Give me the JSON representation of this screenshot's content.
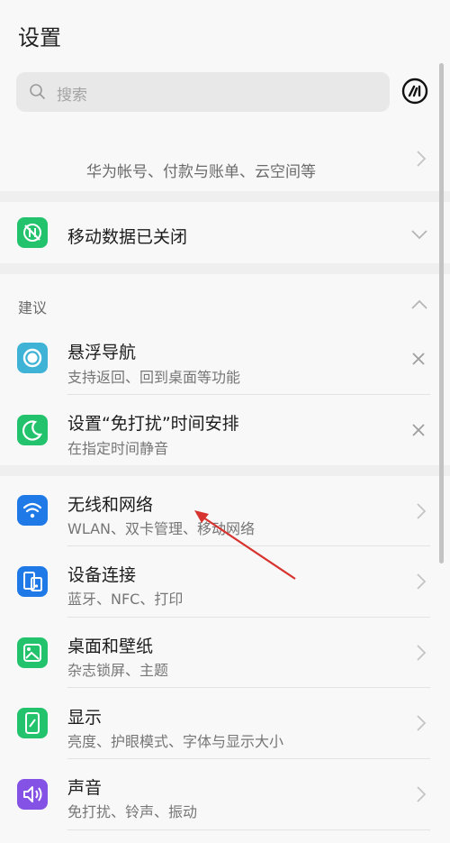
{
  "header": {
    "title": "设置"
  },
  "search": {
    "placeholder": "搜索"
  },
  "account": {
    "subtitle": "华为帐号、付款与账单、云空间等"
  },
  "mobile_data": {
    "label": "移动数据已关闭"
  },
  "suggestions": {
    "header": "建议",
    "items": [
      {
        "title": "悬浮导航",
        "subtitle": "支持返回、回到桌面等功能"
      },
      {
        "title": "设置“免打扰”时间安排",
        "subtitle": "在指定时间静音"
      }
    ]
  },
  "settings": {
    "items": [
      {
        "title": "无线和网络",
        "subtitle": "WLAN、双卡管理、移动网络",
        "icon": "wifi-icon"
      },
      {
        "title": "设备连接",
        "subtitle": "蓝牙、NFC、打印",
        "icon": "device-connection-icon"
      },
      {
        "title": "桌面和壁纸",
        "subtitle": "杂志锁屏、主题",
        "icon": "wallpaper-icon"
      },
      {
        "title": "显示",
        "subtitle": "亮度、护眼模式、字体与显示大小",
        "icon": "display-icon"
      },
      {
        "title": "声音",
        "subtitle": "免打扰、铃声、振动",
        "icon": "sound-icon"
      }
    ]
  },
  "colors": {
    "blue": "#1f7ae8",
    "green": "#23c26d",
    "purple": "#8453e6",
    "teal": "#3fb3d6",
    "arrow": "#d6322e"
  }
}
